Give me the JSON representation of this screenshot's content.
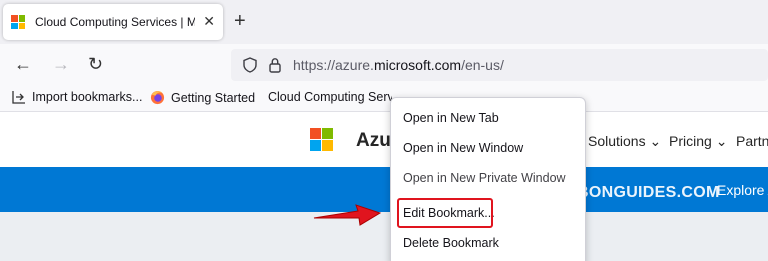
{
  "browser": {
    "tab": {
      "title": "Cloud Computing Services | Microsoft Azure",
      "close_glyph": "✕"
    },
    "new_tab_glyph": "+",
    "nav": {
      "back_glyph": "←",
      "forward_glyph": "→",
      "reload_glyph": "↻"
    },
    "url": {
      "prefix": "https://azure.",
      "domain": "microsoft.com",
      "path": "/en-us/"
    }
  },
  "bookmarks_bar": {
    "items": [
      {
        "label": "Import bookmarks...",
        "icon": "import-icon"
      },
      {
        "label": "Getting Started",
        "icon": "firefox-icon"
      },
      {
        "label": "Cloud Computing Services | Microsoft Azure",
        "icon": "microsoft-logo"
      }
    ]
  },
  "page": {
    "title": "Azure",
    "nav_items": [
      "Solutions",
      "Pricing",
      "Partners"
    ],
    "explore_label": "Explore A"
  },
  "context_menu": {
    "items": [
      "Open in New Tab",
      "Open in New Window",
      "Open in New Private Window",
      "Edit Bookmark...",
      "Delete Bookmark"
    ]
  },
  "watermark": {
    "letter": "B",
    "text": "BONGUIDES.COM"
  },
  "colors": {
    "ms_red": "#f25022",
    "ms_green": "#7fba00",
    "ms_blue": "#00a4ef",
    "ms_yellow": "#ffb900",
    "azure_blue": "#0078d4",
    "highlight_red": "#e0141e",
    "watermark_orange": "#f0a030"
  }
}
